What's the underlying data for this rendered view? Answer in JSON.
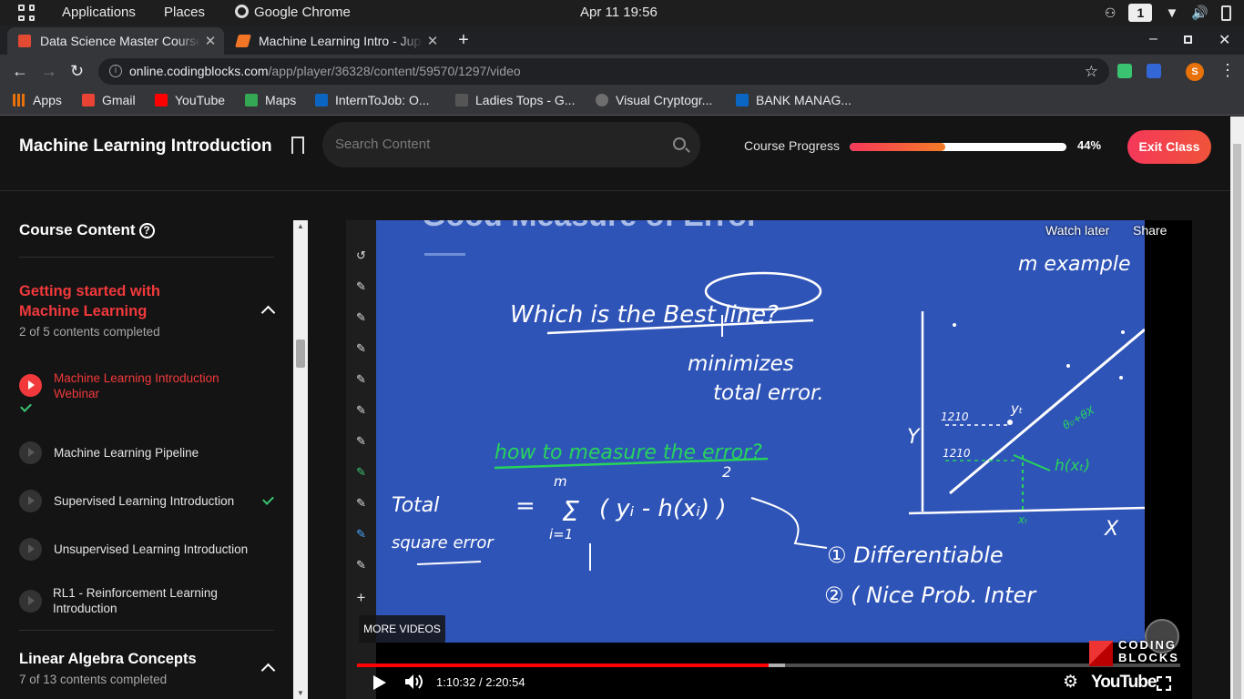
{
  "system_bar": {
    "applications": "Applications",
    "places": "Places",
    "chrome": "Google Chrome",
    "datetime": "Apr 11  19:56",
    "workspace": "1"
  },
  "tabs": [
    {
      "title": "Data Science Master Course",
      "favicon_color": "#e24a32"
    },
    {
      "title": "Machine Learning Intro - Jupyter",
      "favicon_color": "#f37626"
    }
  ],
  "address_bar": {
    "host": "online.codingblocks.com",
    "path": "/app/player/36328/content/59570/1297/video"
  },
  "bookmarks": [
    {
      "label": "Apps",
      "color": "#e8710a"
    },
    {
      "label": "Gmail",
      "color": "#ea4335"
    },
    {
      "label": "YouTube",
      "color": "#ff0000"
    },
    {
      "label": "Maps",
      "color": "#34a853"
    },
    {
      "label": "InternToJob: O...",
      "color": "#0a66c2"
    },
    {
      "label": "Ladies Tops - G...",
      "color": "#555555"
    },
    {
      "label": "Visual Cryptogr...",
      "color": "#6e6e6e"
    },
    {
      "label": "BANK MANAG...",
      "color": "#0a66c2"
    }
  ],
  "profile_initial": "S",
  "header": {
    "course_title": "Machine Learning Introduction",
    "search_placeholder": "Search Content",
    "progress_label": "Course Progress",
    "progress_value": 0.44,
    "progress_text": "44%",
    "exit_label": "Exit Class"
  },
  "sidebar": {
    "heading": "Course Content",
    "sections": [
      {
        "title_line1": "Getting started with",
        "title_line2": "Machine Learning",
        "subtitle": "2 of 5 contents completed",
        "lessons": [
          {
            "line1": "Machine Learning Introduction",
            "line2": "Webinar",
            "active": true,
            "completed": true
          },
          {
            "line1": "Machine Learning Pipeline",
            "line2": "",
            "active": false,
            "completed": false
          },
          {
            "line1": "Supervised Learning Introduction",
            "line2": "",
            "active": false,
            "completed": true
          },
          {
            "line1": "Unsupervised Learning Introduction",
            "line2": "",
            "active": false,
            "completed": false
          },
          {
            "line1": "RL1 - Reinforcement Learning",
            "line2": "Introduction",
            "active": false,
            "completed": false
          }
        ]
      },
      {
        "title_line1": "Linear Algebra Concepts",
        "subtitle": "7 of 13 contents completed"
      }
    ]
  },
  "video": {
    "watch_later": "Watch later",
    "share": "Share",
    "more_videos": "MORE VIDEOS",
    "time": "1:10:32 / 2:20:54",
    "played_fraction": 0.5,
    "buffered_fraction": 0.52,
    "youtube_label": "YouTube",
    "logo_line1": "CODING",
    "logo_line2": "BLOCKS",
    "board": {
      "title": "Good Measure of Error",
      "q1": "Which is the Best line?",
      "a1a": "minimizes",
      "a1b": "total error.",
      "q2": "how to measure the error?",
      "total": "Total",
      "sq": "square error",
      "formula_lhs": "=",
      "sum_top": "m",
      "sum_bottom": "i=1",
      "formula_body": "( yᵢ - h(xᵢ) )",
      "power": "2",
      "p1": "① Differentiable",
      "p2": "② ( Nice Prob. Inter",
      "example": "m example",
      "y_axis": "Y",
      "x_axis": "X",
      "tick1": "1210",
      "tick2": "1210",
      "yt": "yₜ",
      "hx": "h(xₜ)",
      "xt": "xₜ",
      "theta": "θ₀+θX"
    }
  }
}
